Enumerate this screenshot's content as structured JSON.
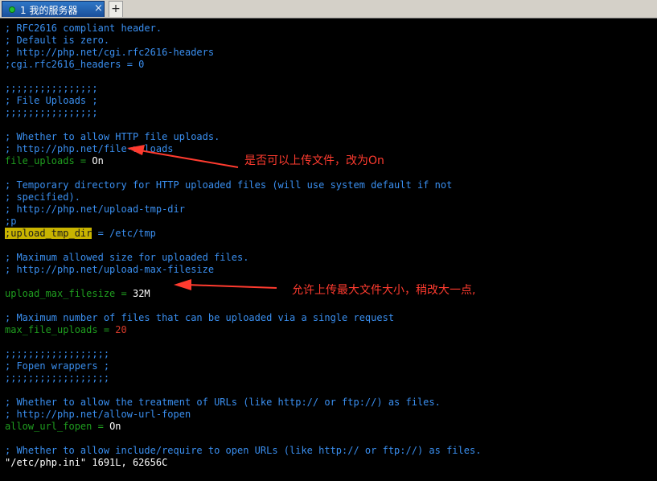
{
  "tab": {
    "label": "1 我的服务器",
    "close": "×",
    "add": "+"
  },
  "editor": {
    "lines": {
      "l1": "; RFC2616 compliant header.",
      "l2": "; Default is zero.",
      "l3": "; http://php.net/cgi.rfc2616-headers",
      "l4": ";cgi.rfc2616_headers = 0",
      "l5": ";;;;;;;;;;;;;;;;",
      "l6": "; File Uploads ;",
      "l7": ";;;;;;;;;;;;;;;;",
      "l8": "; Whether to allow HTTP file uploads.",
      "l9": "; http://php.net/file-uploads",
      "l10_key": "file_uploads",
      "l10_eq": " = ",
      "l10_val": "On",
      "l11": "; Temporary directory for HTTP uploaded files (will use system default if not",
      "l12": "; specified).",
      "l13": "; http://php.net/upload-tmp-dir",
      "l14": ";p",
      "l15_key": ";upload_tmp_dir",
      "l15_rest": " = /etc/tmp",
      "l16": "; Maximum allowed size for uploaded files.",
      "l17": "; http://php.net/upload-max-filesize",
      "l18_key": "upload_max_filesize",
      "l18_eq": " = ",
      "l18_val": "32M",
      "l19": "; Maximum number of files that can be uploaded via a single request",
      "l20_key": "max_file_uploads",
      "l20_eq": " = ",
      "l20_val": "20",
      "l21": ";;;;;;;;;;;;;;;;;;",
      "l22": "; Fopen wrappers ;",
      "l23": ";;;;;;;;;;;;;;;;;;",
      "l24": "; Whether to allow the treatment of URLs (like http:// or ftp://) as files.",
      "l25": "; http://php.net/allow-url-fopen",
      "l26_key": "allow_url_fopen",
      "l26_eq": " = ",
      "l26_val": "On",
      "l27": "; Whether to allow include/require to open URLs (like http:// or ftp://) as files."
    },
    "status": "\"/etc/php.ini\" 1691L, 62656C"
  },
  "annotations": {
    "a1": "是否可以上传文件，改为On",
    "a2": "允许上传最大文件大小，稍改大一点,"
  },
  "colors": {
    "comment": "#3a8ff0",
    "key": "#1f9e1f",
    "value": "#ffffff",
    "number": "#d83a2a",
    "annotation": "#ff3b2f",
    "highlight": "#c9b400"
  }
}
